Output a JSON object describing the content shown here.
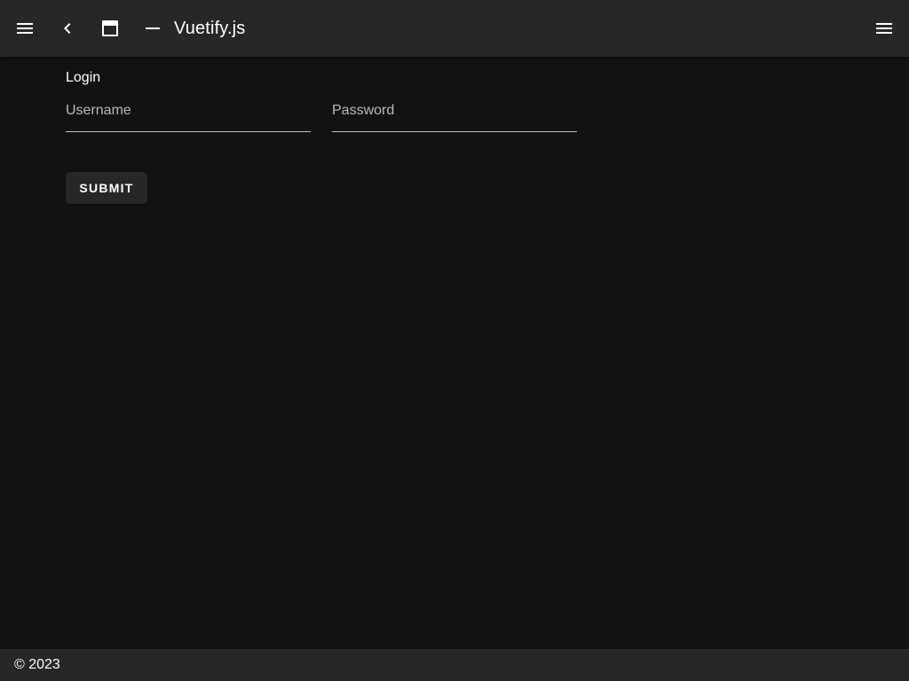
{
  "app_bar": {
    "title": "Vuetify.js",
    "icons": {
      "nav_menu": "menu-icon",
      "back": "chevron-left-icon",
      "window": "window-maximize-icon",
      "minimize": "minus-icon",
      "right_menu": "menu-icon"
    },
    "background": "#272727"
  },
  "form": {
    "title": "Login",
    "username": {
      "placeholder": "Username",
      "value": ""
    },
    "password": {
      "placeholder": "Password",
      "value": ""
    },
    "submit_label": "Submit"
  },
  "footer": {
    "text": "© 2023"
  },
  "colors": {
    "background": "#121212",
    "surface": "#272727",
    "text": "#ffffff"
  }
}
